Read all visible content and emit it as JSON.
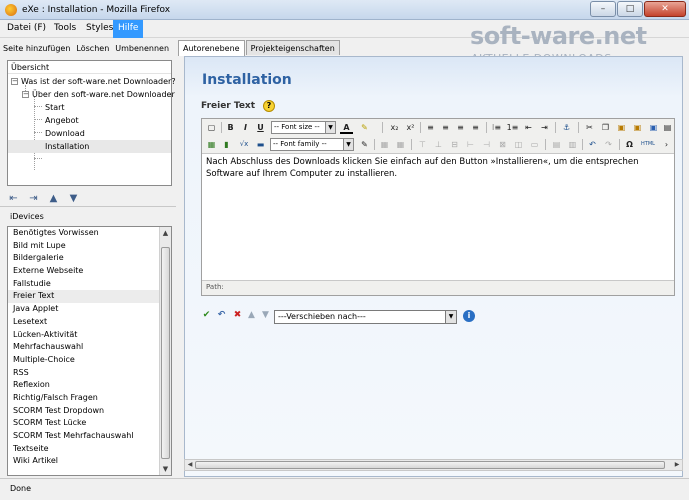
{
  "window": {
    "title": "eXe : Installation - Mozilla Firefox",
    "minimize": "–",
    "maximize": "□",
    "close": "✕"
  },
  "menu": {
    "items": [
      "Datei (F)",
      "Tools",
      "Styles",
      "Hilfe"
    ]
  },
  "outline": {
    "toolbar": [
      "Seite hinzufügen",
      "Löschen",
      "Umbenennen"
    ],
    "header": "Übersicht",
    "nodes": [
      "Was ist der soft-ware.net Downloader?",
      "Über den soft-ware.net Downloader",
      "Start",
      "Angebot",
      "Download",
      "Installation"
    ],
    "selected": "Installation"
  },
  "idevices": {
    "label": "iDevices",
    "items": [
      "Benötigtes Vorwissen",
      "Bild mit Lupe",
      "Bildergalerie",
      "Externe Webseite",
      "Fallstudie",
      "Freier Text",
      "Java Applet",
      "Lesetext",
      "Lücken-Aktivität",
      "Mehrfachauswahl",
      "Multiple-Choice",
      "RSS",
      "Reflexion",
      "Richtig/Falsch Fragen",
      "SCORM Test Dropdown",
      "SCORM Test Lücke",
      "SCORM Test Mehrfachauswahl",
      "Textseite",
      "Wiki Artikel"
    ],
    "selected": "Freier Text"
  },
  "tabs": [
    "Autorenebene",
    "Projekteigenschaften"
  ],
  "main": {
    "title": "Installation",
    "section_label": "Freier Text",
    "help": "?",
    "editor": {
      "font_size": "-- Font size --",
      "font_family": "-- Font family --",
      "line1": "Nach Abschluss des Downloads klicken Sie einfach auf den Button »Installieren«, um die entsprechen",
      "line2": "Software auf Ihrem Computer zu installieren.",
      "path": "Path:"
    },
    "move_select": "---Verschieben nach---",
    "info": "i"
  },
  "status": "Done",
  "logo": {
    "main": "soft-ware.net",
    "sub": "AKTUELLE DOWNLOADS"
  },
  "colors": {
    "accent": "#3399ff",
    "title_blue": "#2e62a3",
    "content_bg": "#dbe7f6"
  },
  "icons": {
    "toolbar_row1": [
      "new-document-icon",
      "bold-icon",
      "italic-icon",
      "underline-icon",
      "font-color-icon",
      "highlight-icon",
      "subscript-icon",
      "superscript-icon",
      "align-left-icon",
      "align-center-icon",
      "align-right-icon",
      "align-justify-icon",
      "bullet-list-icon",
      "numbered-list-icon",
      "outdent-icon",
      "indent-icon",
      "anchor-icon",
      "cut-icon",
      "copy-icon",
      "paste-icon",
      "paste-text-icon",
      "paste-word-icon"
    ],
    "toolbar_row2": [
      "image-icon",
      "media-icon",
      "math-icon",
      "horizontal-rule-icon",
      "edit-icon",
      "table-icon",
      "undo-icon",
      "redo-icon",
      "omega-icon",
      "html-icon"
    ]
  }
}
